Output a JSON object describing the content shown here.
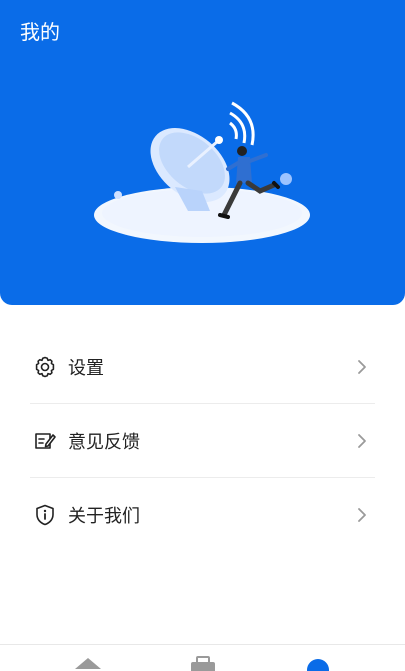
{
  "header": {
    "title": "我的",
    "background_color": "#0a6ce8"
  },
  "menu": {
    "items": [
      {
        "label": "设置",
        "icon": "gear-icon"
      },
      {
        "label": "意见反馈",
        "icon": "feedback-icon"
      },
      {
        "label": "关于我们",
        "icon": "info-shield-icon"
      }
    ]
  },
  "tabbar": {
    "tabs": [
      {
        "icon": "home-icon",
        "active": false
      },
      {
        "icon": "briefcase-icon",
        "active": false
      },
      {
        "icon": "profile-icon",
        "active": true
      }
    ],
    "active_color": "#0a6ce8",
    "inactive_color": "#9a9a9a"
  }
}
